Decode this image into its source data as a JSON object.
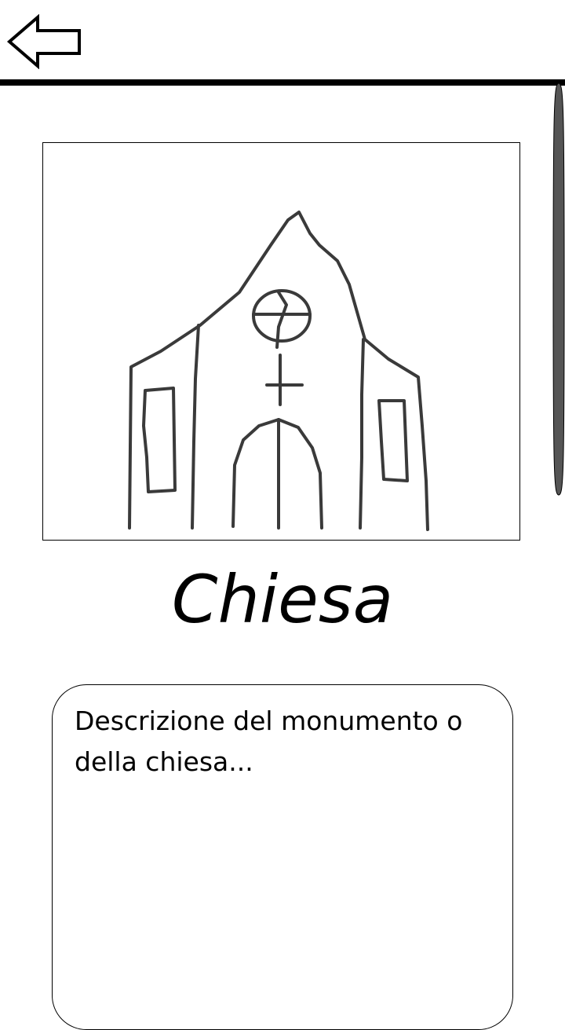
{
  "header": {
    "back_icon": "back-arrow-icon"
  },
  "main": {
    "image": {
      "icon": "church-drawing-icon",
      "stroke_color": "#3a3a3a"
    },
    "title": "Chiesa",
    "description": "Descrizione del monumento o della chiesa..."
  },
  "scrollbar": {
    "color": "#555555"
  }
}
